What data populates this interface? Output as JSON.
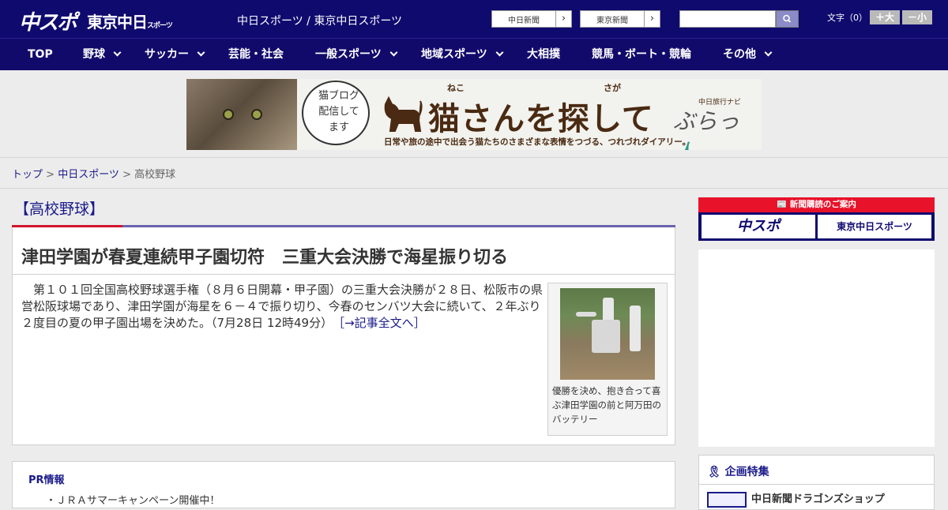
{
  "header": {
    "logo_chunichi": "中スポ",
    "logo_tokyo": "東京中日",
    "logo_tokyo_small": "スポーツ",
    "site_title": "中日スポーツ / 東京中日スポーツ",
    "paper_links": [
      {
        "label": "中日新聞"
      },
      {
        "label": "東京新聞"
      }
    ],
    "search": {
      "value": "",
      "icon": "search-icon"
    },
    "font_size": {
      "label": "文字（0）",
      "increase": "＋大",
      "decrease": "－小"
    }
  },
  "nav": {
    "items": [
      {
        "label": "TOP",
        "dropdown": false
      },
      {
        "label": "野球",
        "dropdown": true
      },
      {
        "label": "サッカー",
        "dropdown": true
      },
      {
        "label": "芸能・社会",
        "dropdown": false
      },
      {
        "label": "一般スポーツ",
        "dropdown": true
      },
      {
        "label": "地域スポーツ",
        "dropdown": true
      },
      {
        "label": "大相撲",
        "dropdown": false
      },
      {
        "label": "競馬・ボート・競輪",
        "dropdown": false
      },
      {
        "label": "その他",
        "dropdown": true
      }
    ]
  },
  "banner": {
    "ruby_neko": "ねこ",
    "ruby_saga": "さが",
    "bubble_text": "猫ブログ配信してます",
    "title": "猫さんを探して",
    "subtitle": "日常や旅の途中で出会う猫たちのさまざまな表情をつづる、つれづれダイアリー。",
    "navi_label": "中日旅行ナビ",
    "brand_a": "ぶらっ",
    "brand_b": "人"
  },
  "breadcrumb": {
    "top": "トップ",
    "sep": " > ",
    "section": "中日スポーツ",
    "current": "高校野球"
  },
  "category": {
    "heading": "【高校野球】"
  },
  "article": {
    "headline": "津田学園が春夏連続甲子園切符　三重大会決勝で海星振り切る",
    "body": "　第１０１回全国高校野球選手権（８月６日開幕・甲子園）の三重大会決勝が２８日、松阪市の県営松阪球場であり、津田学園が海星を６－４で振り切り、今春のセンバツ大会に続いて、２年ぶり２度目の夏の甲子園出場を決めた。（7月28日 12時49分）",
    "more_link": "［→記事全文へ］",
    "caption": "優勝を決め、抱き合って喜ぶ津田学園の前と阿万田のバッテリー"
  },
  "pr": {
    "title": "PR情報",
    "item": "・ＪＲＡサマーキャンペーン開催中！"
  },
  "sidebar": {
    "subscription_head": "新聞購読のご案内",
    "subscription_buttons": [
      "中スポ",
      "東京中日スポーツ"
    ],
    "feature_title": "企画特集",
    "feature_item": "中日新聞ドラゴンズショップ"
  },
  "colors": {
    "header_bg": "#0f0a6e",
    "accent_red": "#d0162c",
    "link": "#1a1a8a"
  }
}
